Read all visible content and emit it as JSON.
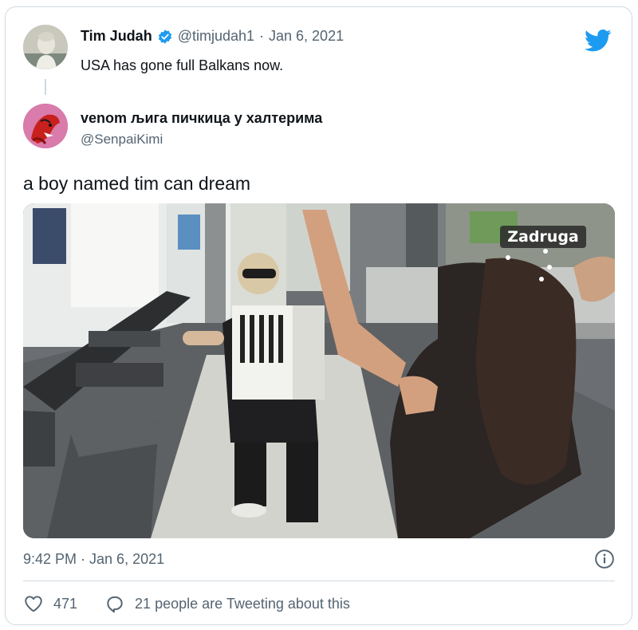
{
  "quote_tweet": {
    "display_name": "Tim Judah",
    "handle": "@timjudah1",
    "separator": "·",
    "date": "Jan 6, 2021",
    "text": "USA has gone full Balkans now."
  },
  "original_tweet": {
    "display_name": "venom љига пичкица у халтерима",
    "handle": "@SenpaiKimi",
    "text": "a boy named tim can dream",
    "media_overlay_text": "Zadruga",
    "timestamp": "9:42 PM · Jan 6, 2021",
    "like_count": "471",
    "tweeting_text": "21 people are Tweeting about this"
  },
  "icons": {
    "verified": "verified-badge-icon",
    "brand": "twitter-bird-icon",
    "info": "info-icon",
    "like": "heart-icon",
    "reply": "speech-bubble-icon"
  },
  "colors": {
    "brand_blue": "#1d9bf0",
    "secondary_text": "#536471",
    "border": "#cfd9de"
  }
}
